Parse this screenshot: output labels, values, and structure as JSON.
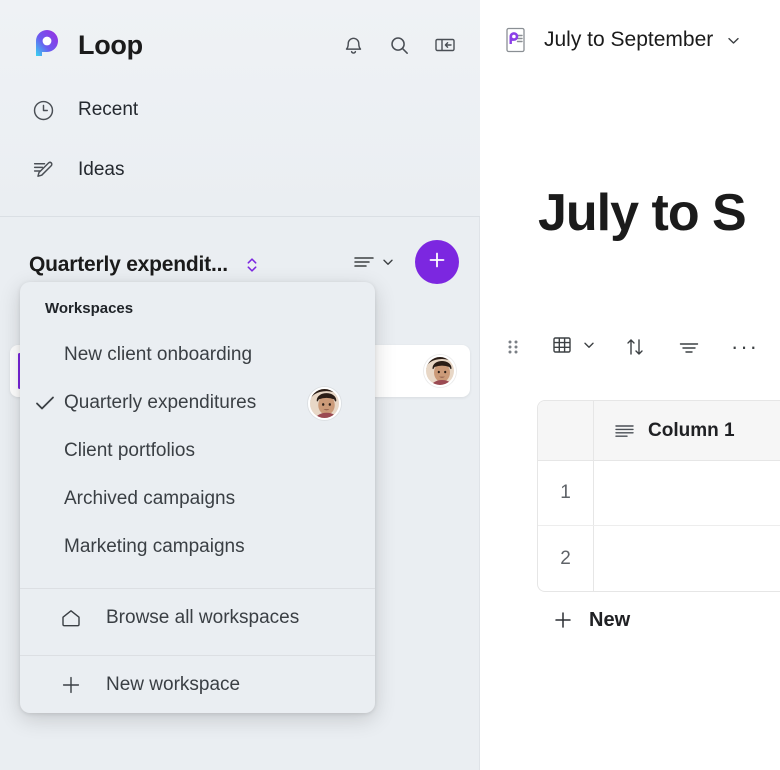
{
  "brand": {
    "name": "Loop",
    "logo_icon": "loop-logo-icon",
    "accent_color": "#7c27e0"
  },
  "sidebar": {
    "header_icons": [
      {
        "name": "notifications-bell-icon"
      },
      {
        "name": "search-icon"
      },
      {
        "name": "collapse-sidebar-icon"
      }
    ],
    "nav": [
      {
        "label": "Recent",
        "icon": "clock-icon"
      },
      {
        "label": "Ideas",
        "icon": "pencil-edit-icon"
      }
    ],
    "workspace_row": {
      "title": "Quarterly expendit...",
      "switch_icon": "chevron-up-down-icon",
      "sort_icon": "sort-lines-icon",
      "sort_chevron_icon": "chevron-down-icon",
      "add_label": "+",
      "add_icon": "plus-icon"
    }
  },
  "workspace_menu": {
    "heading": "Workspaces",
    "options": [
      {
        "label": "New client onboarding",
        "checked": false,
        "has_avatar": false
      },
      {
        "label": "Quarterly expenditures",
        "checked": true,
        "has_avatar": true
      },
      {
        "label": "Client portfolios",
        "checked": false,
        "has_avatar": false
      },
      {
        "label": "Archived campaigns",
        "checked": false,
        "has_avatar": false
      },
      {
        "label": "Marketing campaigns",
        "checked": false,
        "has_avatar": false
      }
    ],
    "check_icon": "checkmark-icon",
    "actions": [
      {
        "label": "Browse all workspaces",
        "icon": "home-icon"
      },
      {
        "label": "New workspace",
        "icon": "plus-icon"
      }
    ]
  },
  "panel": {
    "doc_header": {
      "icon": "loop-page-document-icon",
      "title": "July to September",
      "chevron_icon": "chevron-down-icon"
    },
    "page_title": "July to S",
    "toolbar": [
      {
        "name": "drag-handle-icon"
      },
      {
        "name": "table-grid-icon"
      },
      {
        "name": "chevron-down-icon"
      },
      {
        "name": "sort-arrows-icon"
      },
      {
        "name": "filter-icon"
      },
      {
        "name": "more-options-icon",
        "label": "···"
      }
    ],
    "table": {
      "columns": [
        {
          "label": "Column 1",
          "icon": "text-column-icon"
        }
      ],
      "rows": [
        {
          "number": "1",
          "cells": [
            ""
          ]
        },
        {
          "number": "2",
          "cells": [
            ""
          ]
        }
      ],
      "new_row_label": "New",
      "new_row_icon": "plus-icon"
    }
  }
}
